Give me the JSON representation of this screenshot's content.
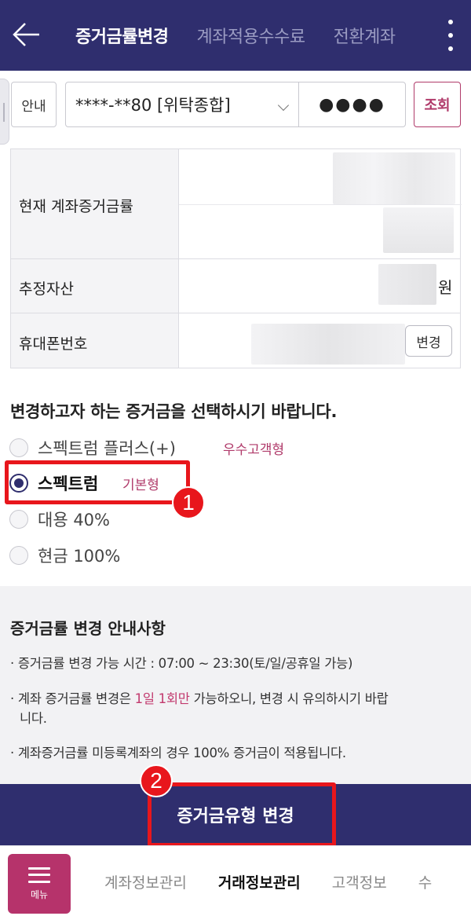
{
  "header": {
    "tabs": [
      {
        "label": "증거금률변경",
        "active": true
      },
      {
        "label": "계좌적용수수료",
        "active": false
      },
      {
        "label": "전환계좌",
        "active": false
      }
    ]
  },
  "account_bar": {
    "guide_label": "안내",
    "account_value": "****-**80 [위탁종합]",
    "password_value": "●●●●",
    "query_label": "조회"
  },
  "info_table": {
    "rows": [
      {
        "label": "현재 계좌증거금률"
      },
      {
        "label": "추정자산",
        "unit": "원"
      },
      {
        "label": "휴대폰번호",
        "button": "변경"
      }
    ]
  },
  "selection": {
    "title": "변경하고자 하는 증거금을 선택하시기 바랍니다.",
    "options": [
      {
        "label": "스펙트럼 플러스(+)",
        "tag": "우수고객형",
        "selected": false
      },
      {
        "label": "스펙트럼",
        "tag": "기본형",
        "selected": true
      },
      {
        "label": "대용 40%",
        "tag": "",
        "selected": false
      },
      {
        "label": "현금 100%",
        "tag": "",
        "selected": false
      }
    ]
  },
  "annotations": {
    "marker1": "1",
    "marker2": "2"
  },
  "notice": {
    "title": "증거금률 변경 안내사항",
    "item1": "· 증거금률 변경 가능 시간 : 07:00 ~ 23:30(토/일/공휴일 가능)",
    "item2_pre": "· 계좌 증거금률 변경은 ",
    "item2_hl": "1일 1회만",
    "item2_post": " 가능하오니, 변경 시 유의하시기 바랍",
    "item2_cont": "니다.",
    "item3": "· 계좌증거금률 미등록계좌의 경우 100% 증거금이 적용됩니다."
  },
  "submit_label": "증거금유형 변경",
  "bottom_nav": {
    "menu_label": "메뉴",
    "items": [
      {
        "label": "계좌정보관리",
        "active": false
      },
      {
        "label": "거래정보관리",
        "active": true
      },
      {
        "label": "고객정보",
        "active": false
      },
      {
        "label": "수",
        "active": false
      }
    ]
  },
  "colors": {
    "primary": "#2f2e6e",
    "accent": "#b03a6a",
    "annotation": "#e8161c"
  }
}
